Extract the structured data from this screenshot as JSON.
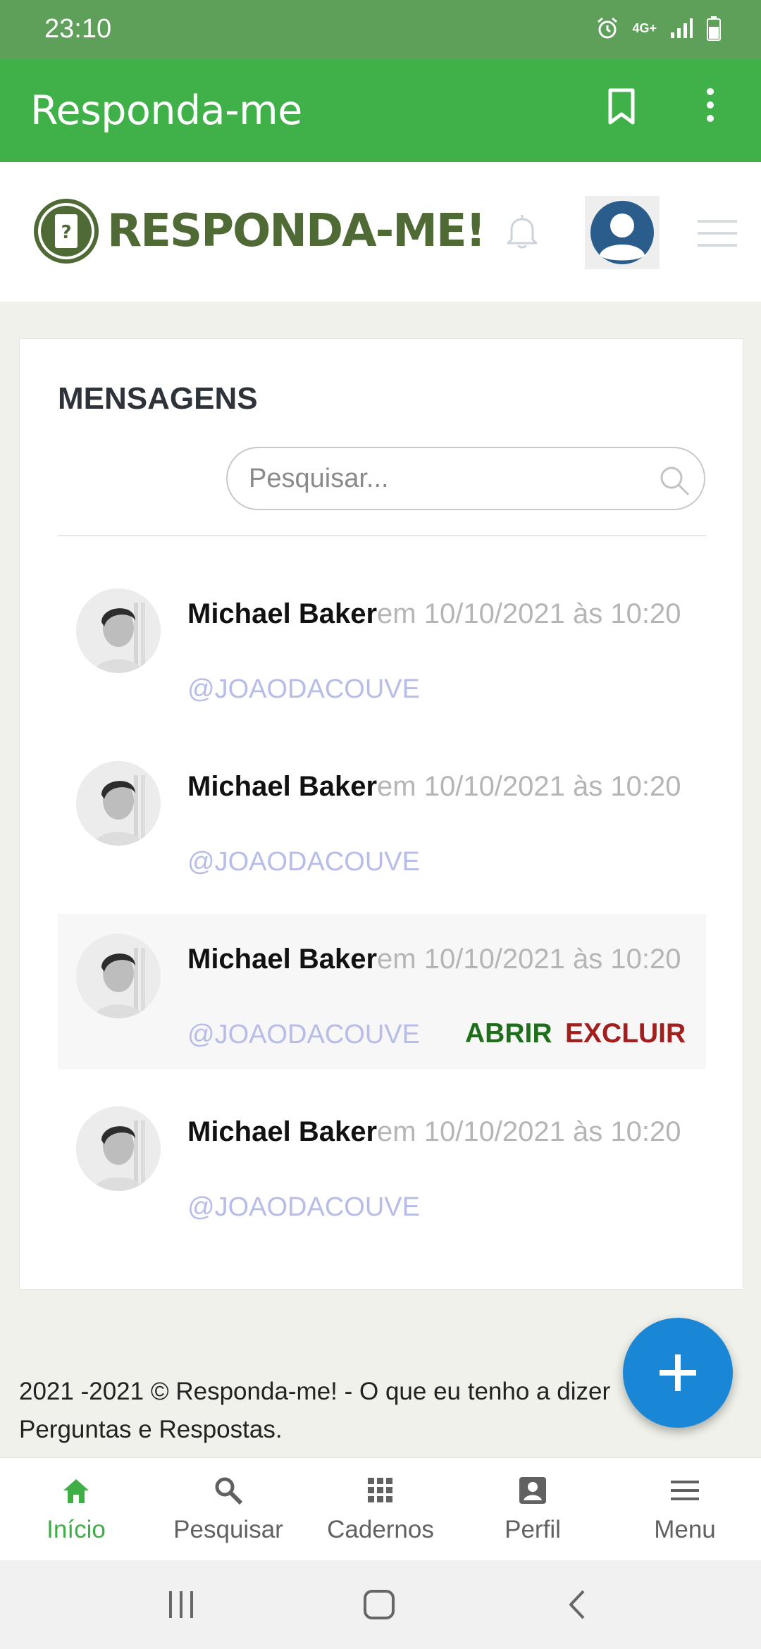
{
  "status_bar": {
    "time": "23:10",
    "network": "4G+",
    "icons": [
      "alarm-icon",
      "signal-icon",
      "battery-icon"
    ]
  },
  "app_bar": {
    "title": "Responda-me",
    "actions": [
      "bookmark-icon",
      "more-vertical-icon"
    ]
  },
  "header": {
    "logo_text": "RESPONDA-ME!",
    "icons": [
      "bell-icon",
      "user-avatar-icon",
      "hamburger-icon"
    ]
  },
  "messages_section": {
    "title": "MENSAGENS",
    "search": {
      "placeholder": "Pesquisar...",
      "value": ""
    },
    "items": [
      {
        "name": "Michael Baker",
        "date": "em 10/10/2021 às 10:20",
        "handle": "@JOAODACOUVE",
        "highlighted": false
      },
      {
        "name": "Michael Baker",
        "date": "em 10/10/2021 às 10:20",
        "handle": "@JOAODACOUVE",
        "highlighted": false
      },
      {
        "name": "Michael Baker",
        "date": "em 10/10/2021 às 10:20",
        "handle": "@JOAODACOUVE",
        "highlighted": true,
        "open_label": "ABRIR",
        "delete_label": "EXCLUIR"
      },
      {
        "name": "Michael Baker",
        "date": "em 10/10/2021 às 10:20",
        "handle": "@JOAODACOUVE",
        "highlighted": false
      }
    ]
  },
  "footer": {
    "text": "2021 -2021 © Responda-me! - O que eu tenho a dizer Perguntas e Respostas."
  },
  "fab": {
    "icon": "plus-icon"
  },
  "bottom_nav": {
    "items": [
      {
        "label": "Início",
        "icon": "home-icon",
        "active": true
      },
      {
        "label": "Pesquisar",
        "icon": "search-icon",
        "active": false
      },
      {
        "label": "Cadernos",
        "icon": "grid-icon",
        "active": false
      },
      {
        "label": "Perfil",
        "icon": "profile-icon",
        "active": false
      },
      {
        "label": "Menu",
        "icon": "menu-icon",
        "active": false
      }
    ]
  },
  "system_nav": {
    "icons": [
      "recents-icon",
      "home-button-icon",
      "back-icon"
    ]
  },
  "colors": {
    "app_bar": "#40b048",
    "status_bar": "#5e9f5a",
    "active_nav": "#3fae46",
    "fab": "#1a86d6",
    "open_action": "#1f6e1c",
    "delete_action": "#a21f1f",
    "handle": "#b7bde8"
  }
}
